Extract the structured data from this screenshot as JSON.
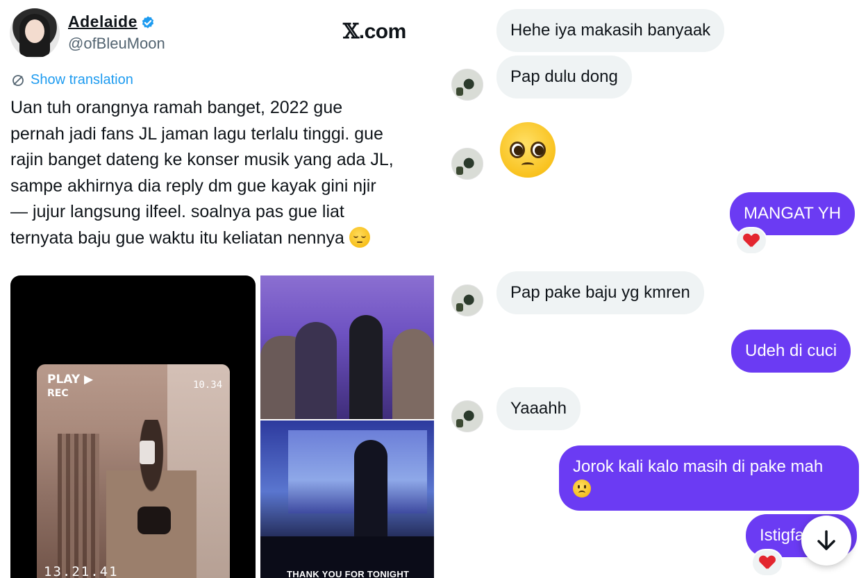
{
  "tweet": {
    "display_name": "Adelaide",
    "handle": "@ofBleuMoon",
    "site_label": ".com",
    "show_translation": "Show translation",
    "text": "Uan tuh orangnya ramah banget, 2022 gue\npernah jadi fans JL jaman lagu terlalu tinggi. gue\nrajin banget dateng ke konser musik yang ada JL,\nsampe akhirnya dia reply dm gue kayak gini njir\n— jujur langsung ilfeel. soalnya pas gue liat\nternyata baju gue waktu itu keliatan nennya",
    "media": {
      "vhs_play": "PLAY",
      "vhs_rec": "REC",
      "vhs_counter": "10.34",
      "vhs_timestamp": "13.21.41",
      "stage_caption": "THANK YOU FOR TONIGHT"
    }
  },
  "chat": {
    "messages": [
      {
        "side": "in",
        "text": "Hehe iya makasih banyaak"
      },
      {
        "side": "in",
        "text": "Pap dulu dong"
      },
      {
        "side": "in",
        "text": "",
        "emoji": "pleading-face"
      },
      {
        "side": "out",
        "text": "MANGAT YH",
        "reaction": "heart"
      },
      {
        "side": "in",
        "text": "Pap pake baju yg kmren"
      },
      {
        "side": "out",
        "text": "Udeh di cuci"
      },
      {
        "side": "in",
        "text": "Yaaahh"
      },
      {
        "side": "out",
        "text": "Jorok kali kalo masih di pake mah",
        "emoji": "frowning-face"
      },
      {
        "side": "out",
        "text": "Istigfa",
        "reaction": "heart"
      }
    ]
  },
  "colors": {
    "link_blue": "#1d9bf0",
    "outgoing_bubble": "#6b3bf3",
    "incoming_bubble": "#eff3f4",
    "verified_badge": "#1d9bf0"
  }
}
